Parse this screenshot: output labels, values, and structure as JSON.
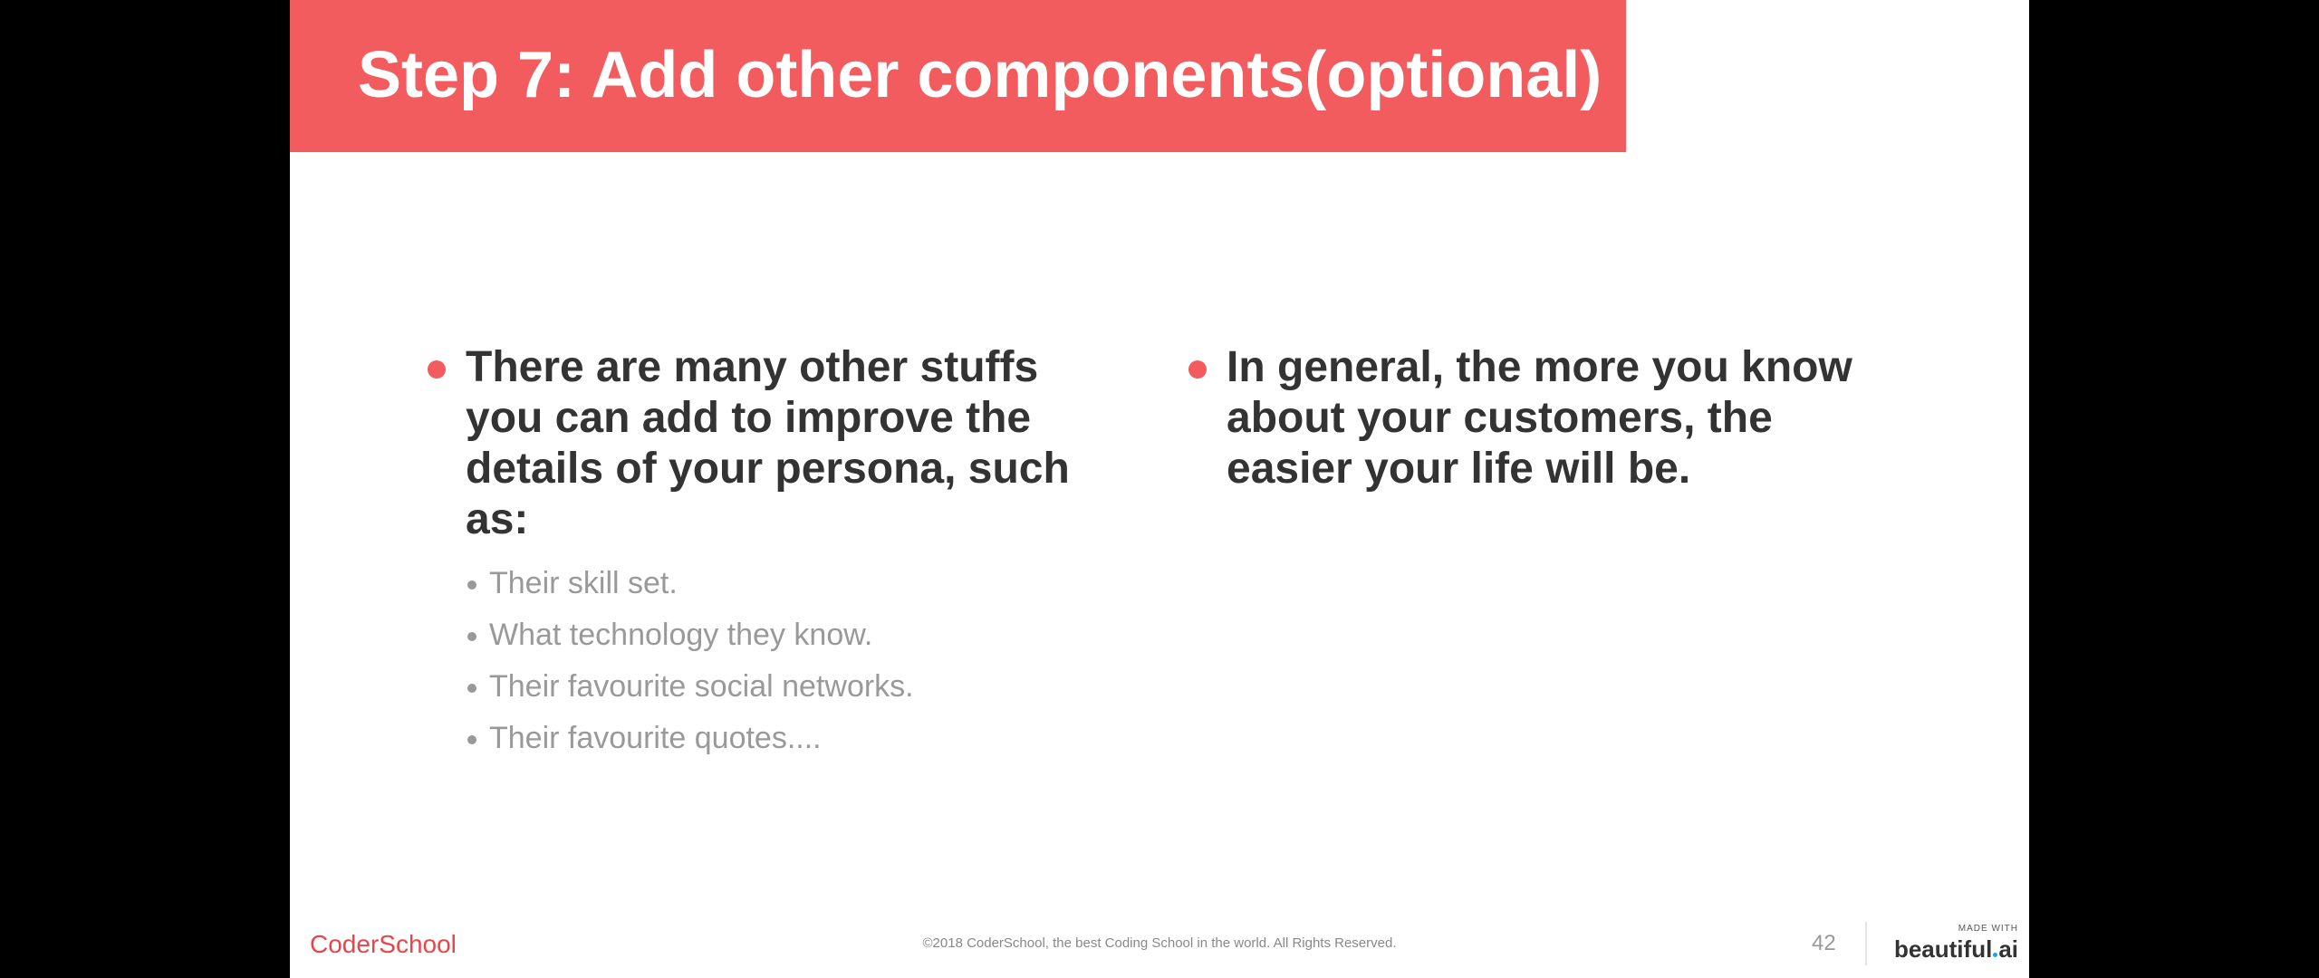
{
  "slide": {
    "title": "Step 7: Add other components(optional)",
    "left_column": {
      "bullet": "There are many other stuffs you can add to improve the details of your persona, such as:",
      "sub_items": [
        "Their skill set.",
        "What technology they know.",
        "Their favourite social networks.",
        "Their favourite quotes...."
      ]
    },
    "right_column": {
      "bullet": "In general, the more you know about your customers, the easier your life will be."
    }
  },
  "footer": {
    "logo": "CoderSchool",
    "copyright": "©2018 CoderSchool, the best Coding School in the world. All Rights Reserved.",
    "page_number": "42",
    "brand_small": "MADE WITH",
    "brand_main_a": "beautiful",
    "brand_main_b": "ai"
  },
  "colors": {
    "accent": "#f25c5e",
    "heading_text": "#333333",
    "sub_text": "#999999",
    "background_outside": "#000000"
  }
}
